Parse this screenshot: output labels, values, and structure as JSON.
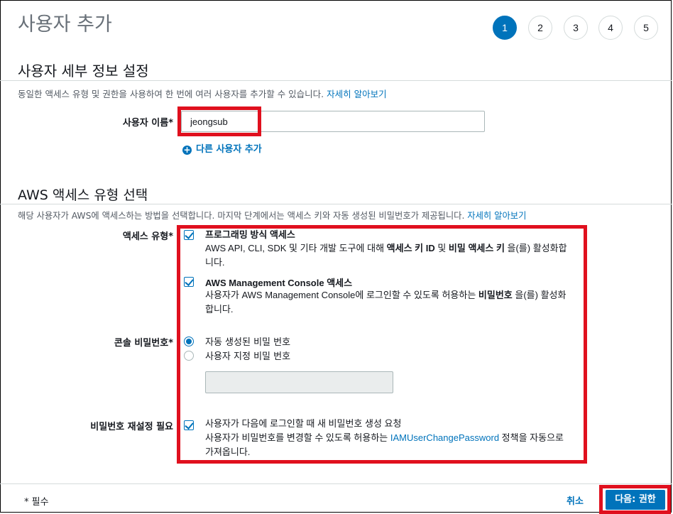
{
  "header": {
    "title": "사용자 추가",
    "steps": [
      {
        "label": "1",
        "active": true
      },
      {
        "label": "2",
        "active": false
      },
      {
        "label": "3",
        "active": false
      },
      {
        "label": "4",
        "active": false
      },
      {
        "label": "5",
        "active": false
      }
    ]
  },
  "user_details": {
    "title": "사용자 세부 정보 설정",
    "description": "동일한 액세스 유형 및 권한을 사용하여 한 번에 여러 사용자를 추가할 수 있습니다. ",
    "learn_more": "자세히 알아보기",
    "username_label": "사용자 이름*",
    "username_value": "jeongsub",
    "add_another_user": "다른 사용자 추가"
  },
  "access_type": {
    "title": "AWS 액세스 유형 선택",
    "description": "해당 사용자가 AWS에 액세스하는 방법을 선택합니다. 마지막 단계에서는 액세스 키와 자동 생성된 비밀번호가 제공됩니다. ",
    "learn_more": "자세히 알아보기",
    "label": "액세스 유형*",
    "programmatic": {
      "title": "프로그래밍 방식 액세스",
      "text_a": "AWS API, CLI, SDK 및 기타 개발 도구에 대해 ",
      "bold_a": "액세스 키 ID",
      "text_b": " 및 ",
      "bold_b": "비밀 액세스 키",
      "text_c": " 을(를) 활성화합니다.",
      "checked": true
    },
    "console": {
      "title": "AWS Management Console 액세스",
      "text_a": "사용자가 AWS Management Console에 로그인할 수 있도록 허용하는 ",
      "bold_a": "비밀번호",
      "text_b": " 을(를) 활성화합니다.",
      "checked": true
    }
  },
  "console_password": {
    "label": "콘솔 비밀번호*",
    "option_auto": "자동 생성된 비밀 번호",
    "option_custom": "사용자 지정 비밀 번호",
    "selected": "auto"
  },
  "password_reset": {
    "label": "비밀번호 재설정 필요",
    "checkbox_text": "사용자가 다음에 로그인할 때 새 비밀번호 생성 요청",
    "text_a": "사용자가 비밀번호를 변경할 수 있도록 허용하는 ",
    "policy_link": "IAMUserChangePassword",
    "text_b": " 정책을 자동으로 가져옵니다.",
    "checked": true
  },
  "footer": {
    "required_note": "* 필수",
    "cancel": "취소",
    "next": "다음: 권한"
  },
  "colors": {
    "accent": "#0073bb",
    "highlight": "#e0101e"
  }
}
